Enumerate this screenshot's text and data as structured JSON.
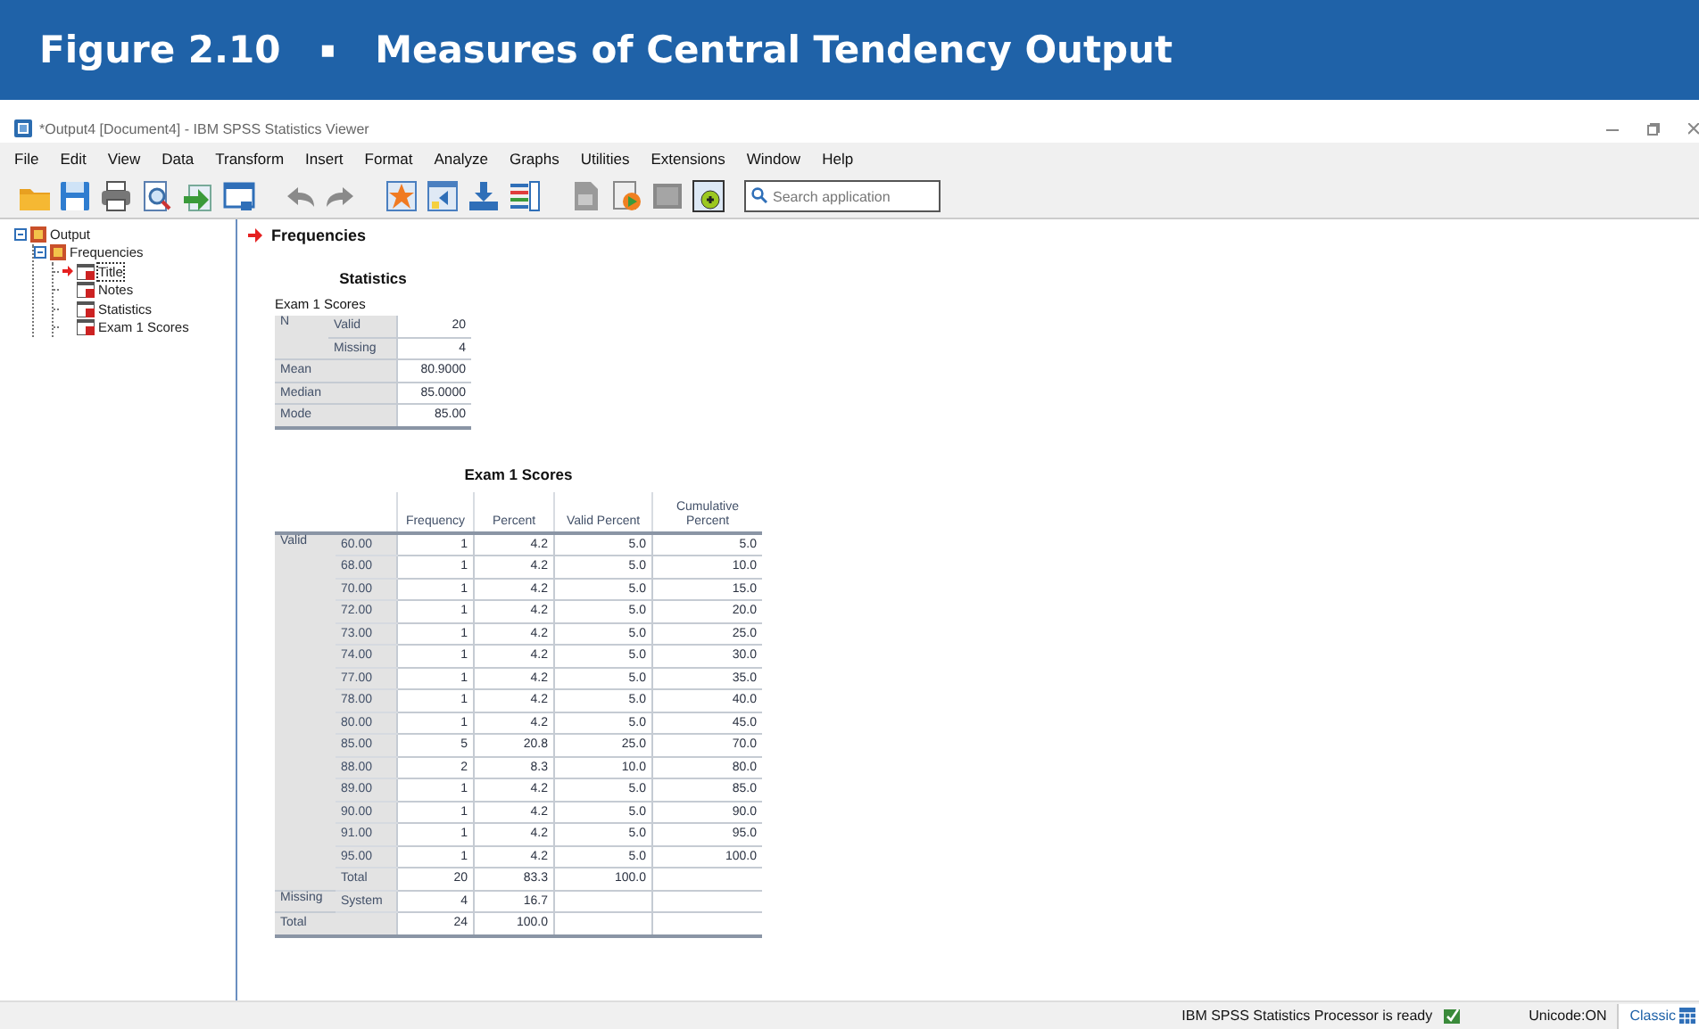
{
  "figure": {
    "number": "Figure 2.10",
    "separator": "▪",
    "title": "Measures of Central Tendency Output"
  },
  "window": {
    "title": "*Output4 [Document4] - IBM SPSS Statistics Viewer"
  },
  "menu": [
    "File",
    "Edit",
    "View",
    "Data",
    "Transform",
    "Insert",
    "Format",
    "Analyze",
    "Graphs",
    "Utilities",
    "Extensions",
    "Window",
    "Help"
  ],
  "search": {
    "placeholder": "Search application"
  },
  "tree": [
    {
      "label": "Output",
      "selected": false,
      "expanded": true,
      "children": [
        {
          "label": "Frequencies",
          "selected": false,
          "expanded": true,
          "children": [
            {
              "label": "Title",
              "selected": true
            },
            {
              "label": "Notes",
              "selected": false
            },
            {
              "label": "Statistics",
              "selected": false
            },
            {
              "label": "Exam 1 Scores",
              "selected": false
            }
          ]
        }
      ]
    }
  ],
  "output_heading": "Frequencies",
  "statistics": {
    "title": "Statistics",
    "variable": "Exam 1 Scores",
    "rows": [
      {
        "kind": "sub",
        "group": "N",
        "label": "Valid",
        "value": "20"
      },
      {
        "kind": "sub",
        "label": "Missing",
        "value": "4"
      },
      {
        "kind": "full",
        "label": "Mean",
        "value": "80.9000"
      },
      {
        "kind": "full",
        "label": "Median",
        "value": "85.0000"
      },
      {
        "kind": "full",
        "label": "Mode",
        "value": "85.00"
      }
    ]
  },
  "frequency_table": {
    "title": "Exam 1 Scores",
    "columns": [
      "Frequency",
      "Percent",
      "Valid Percent",
      "Cumulative Percent"
    ],
    "groups": [
      {
        "label": "Valid",
        "rows": [
          {
            "label": "60.00",
            "cells": [
              "1",
              "4.2",
              "5.0",
              "5.0"
            ]
          },
          {
            "label": "68.00",
            "cells": [
              "1",
              "4.2",
              "5.0",
              "10.0"
            ]
          },
          {
            "label": "70.00",
            "cells": [
              "1",
              "4.2",
              "5.0",
              "15.0"
            ]
          },
          {
            "label": "72.00",
            "cells": [
              "1",
              "4.2",
              "5.0",
              "20.0"
            ]
          },
          {
            "label": "73.00",
            "cells": [
              "1",
              "4.2",
              "5.0",
              "25.0"
            ]
          },
          {
            "label": "74.00",
            "cells": [
              "1",
              "4.2",
              "5.0",
              "30.0"
            ]
          },
          {
            "label": "77.00",
            "cells": [
              "1",
              "4.2",
              "5.0",
              "35.0"
            ]
          },
          {
            "label": "78.00",
            "cells": [
              "1",
              "4.2",
              "5.0",
              "40.0"
            ]
          },
          {
            "label": "80.00",
            "cells": [
              "1",
              "4.2",
              "5.0",
              "45.0"
            ]
          },
          {
            "label": "85.00",
            "cells": [
              "5",
              "20.8",
              "25.0",
              "70.0"
            ]
          },
          {
            "label": "88.00",
            "cells": [
              "2",
              "8.3",
              "10.0",
              "80.0"
            ]
          },
          {
            "label": "89.00",
            "cells": [
              "1",
              "4.2",
              "5.0",
              "85.0"
            ]
          },
          {
            "label": "90.00",
            "cells": [
              "1",
              "4.2",
              "5.0",
              "90.0"
            ]
          },
          {
            "label": "91.00",
            "cells": [
              "1",
              "4.2",
              "5.0",
              "95.0"
            ]
          },
          {
            "label": "95.00",
            "cells": [
              "1",
              "4.2",
              "5.0",
              "100.0"
            ]
          },
          {
            "label": "Total",
            "cells": [
              "20",
              "83.3",
              "100.0"
            ]
          }
        ]
      },
      {
        "label": "Missing",
        "rows": [
          {
            "label": "System",
            "cells": [
              "4",
              "16.7"
            ]
          }
        ]
      }
    ],
    "total": {
      "label": "Total",
      "cells": [
        "24",
        "100.0"
      ]
    }
  },
  "status_bar": {
    "message": "IBM SPSS Statistics Processor is ready",
    "encoding": "Unicode:ON",
    "mode": "Classic"
  }
}
